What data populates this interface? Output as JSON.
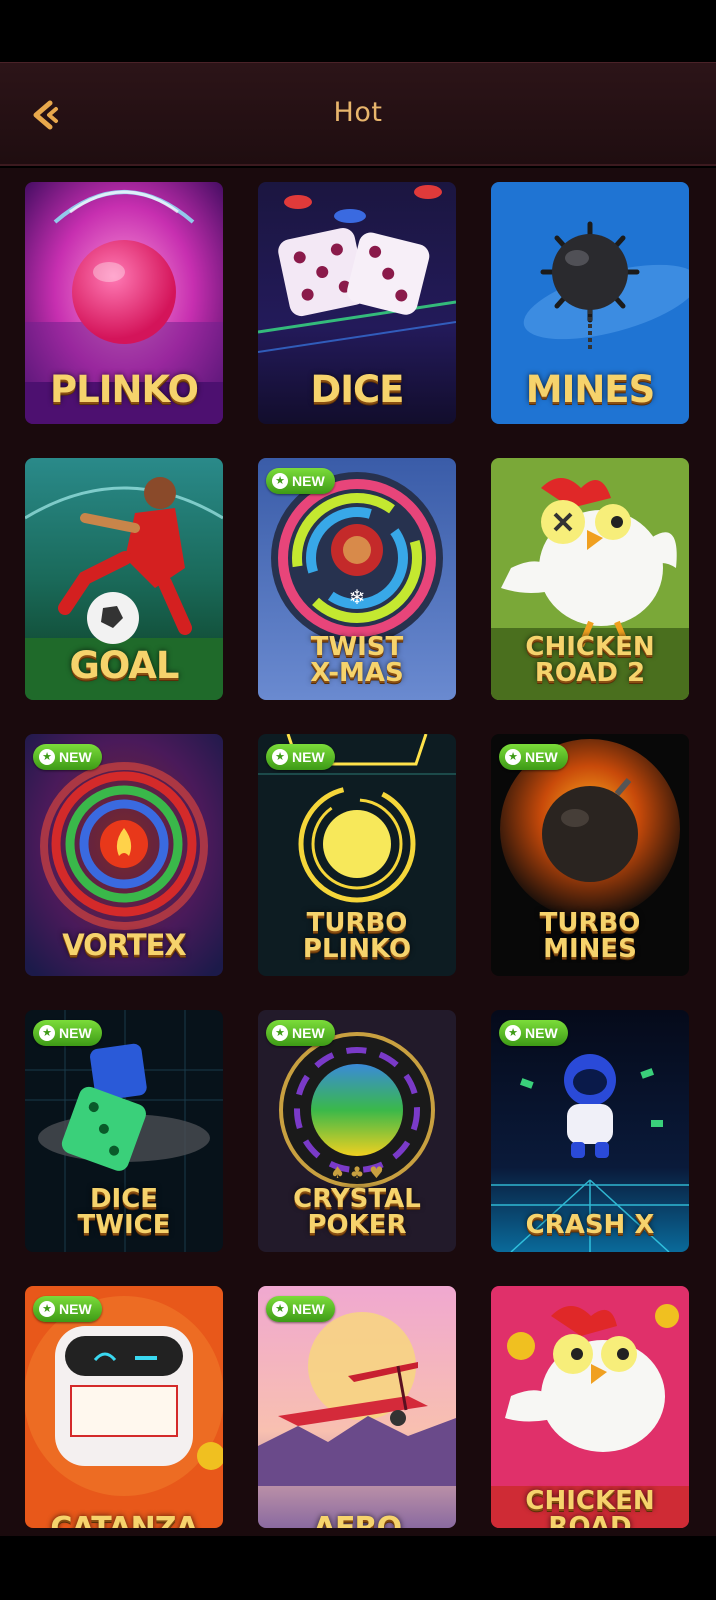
{
  "header": {
    "title": "Hot",
    "back_icon": "back-arrow-icon"
  },
  "colors": {
    "accent": "#e8b56c",
    "background": "#1a0a0d",
    "badge": "#4fb81f"
  },
  "badge_label": "NEW",
  "games": [
    {
      "id": "plinko",
      "name": "PLINKO",
      "new": false
    },
    {
      "id": "dice",
      "name": "DICE",
      "new": false
    },
    {
      "id": "mines",
      "name": "MINES",
      "new": false
    },
    {
      "id": "goal",
      "name": "GOAL",
      "new": false
    },
    {
      "id": "twist-xmas",
      "name": "TWIST\nX-MAS",
      "new": true
    },
    {
      "id": "chicken-road-2",
      "name": "CHICKEN\nROAD 2",
      "new": false
    },
    {
      "id": "vortex",
      "name": "VORTEX",
      "new": true
    },
    {
      "id": "turbo-plinko",
      "name": "TURBO\nPLINKO",
      "new": true
    },
    {
      "id": "turbo-mines",
      "name": "TURBO\nMINES",
      "new": true
    },
    {
      "id": "dice-twice",
      "name": "DICE\nTWICE",
      "new": true
    },
    {
      "id": "crystal-poker",
      "name": "CRYSTAL\nPOKER",
      "new": true
    },
    {
      "id": "crash-x",
      "name": "CRASH X",
      "new": true
    },
    {
      "id": "catanza",
      "name": "CATANZA",
      "new": true
    },
    {
      "id": "aero",
      "name": "AERO",
      "new": true
    },
    {
      "id": "chicken-road",
      "name": "CHICKEN\nROAD",
      "new": false
    }
  ]
}
